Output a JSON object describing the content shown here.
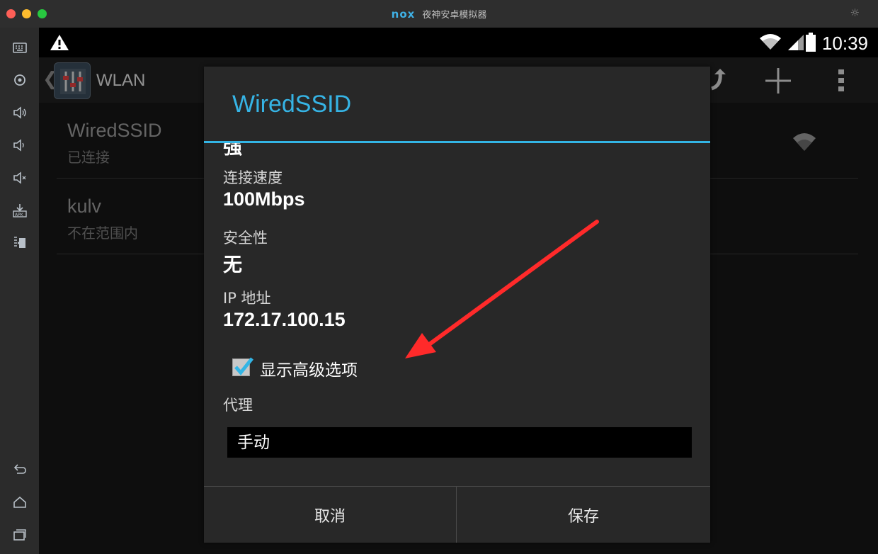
{
  "window": {
    "logo_text": "nox",
    "title": "夜神安卓模拟器",
    "settings_icon": "gear-icon"
  },
  "sidebar": {
    "buttons": [
      {
        "name": "keyboard-icon"
      },
      {
        "name": "location-icon"
      },
      {
        "name": "volume-up-icon"
      },
      {
        "name": "volume-down-icon"
      },
      {
        "name": "mute-icon"
      },
      {
        "name": "apk-install-icon"
      },
      {
        "name": "multi-window-icon"
      },
      {
        "name": "back-icon"
      },
      {
        "name": "home-icon"
      },
      {
        "name": "recents-icon"
      }
    ]
  },
  "statusbar": {
    "time": "10:39",
    "icons": [
      "warning-icon",
      "wifi-icon",
      "signal-icon",
      "battery-icon"
    ]
  },
  "actionbar": {
    "title": "WLAN",
    "actions": [
      "refresh-icon",
      "add-icon",
      "overflow-menu-icon"
    ]
  },
  "wifi_list": [
    {
      "ssid": "WiredSSID",
      "status": "已连接"
    },
    {
      "ssid": "kulv",
      "status": "不在范围内"
    }
  ],
  "dialog": {
    "title": "WiredSSID",
    "signal_value": "强",
    "speed_label": "连接速度",
    "speed_value": "100Mbps",
    "security_label": "安全性",
    "security_value": "无",
    "ip_label": "IP 地址",
    "ip_value": "172.17.100.15",
    "advanced_label": "显示高级选项",
    "advanced_checked": true,
    "proxy_label": "代理",
    "proxy_value": "手动",
    "cancel_label": "取消",
    "save_label": "保存"
  },
  "colors": {
    "accent": "#33b5e5",
    "annotation": "#ff2a2a"
  }
}
